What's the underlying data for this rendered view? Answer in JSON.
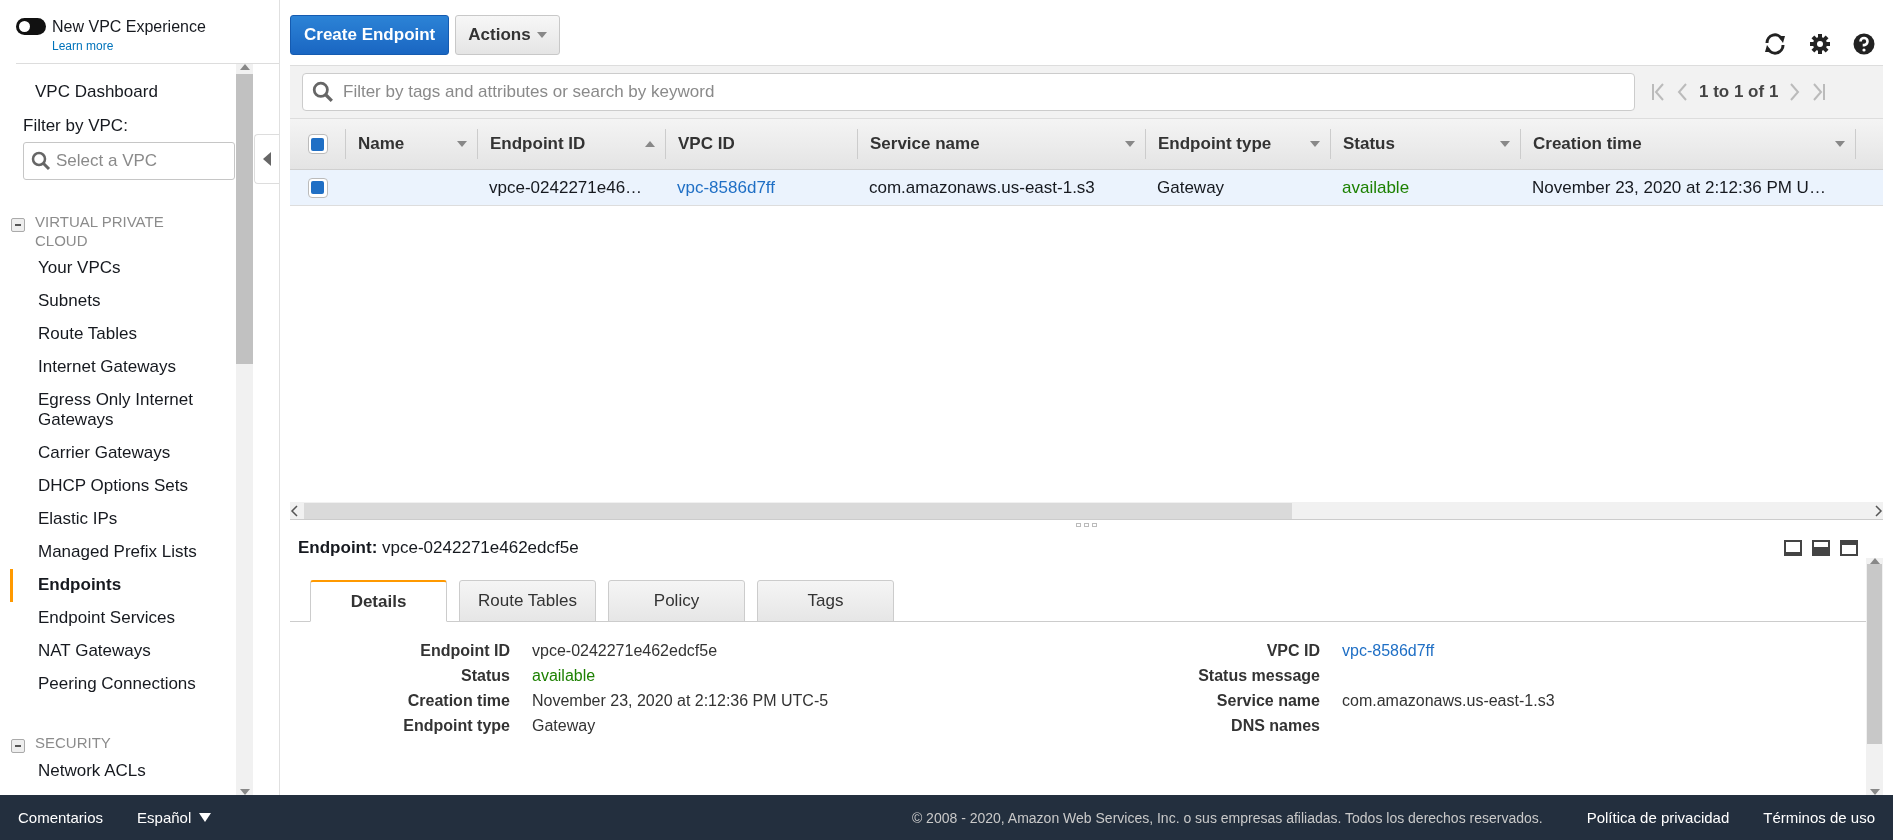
{
  "sidebar": {
    "toggle": {
      "label": "New VPC Experience",
      "on": false
    },
    "learn_more": "Learn more",
    "dashboard": "VPC Dashboard",
    "filter_label": "Filter by VPC:",
    "filter": {
      "placeholder": "Select a VPC"
    },
    "sections": [
      {
        "title": "VIRTUAL PRIVATE CLOUD",
        "expanded": true,
        "items": [
          {
            "label": "Your VPCs",
            "selected": false
          },
          {
            "label": "Subnets",
            "selected": false
          },
          {
            "label": "Route Tables",
            "selected": false
          },
          {
            "label": "Internet Gateways",
            "selected": false
          },
          {
            "label": "Egress Only Internet Gateways",
            "selected": false
          },
          {
            "label": "Carrier Gateways",
            "selected": false
          },
          {
            "label": "DHCP Options Sets",
            "selected": false
          },
          {
            "label": "Elastic IPs",
            "selected": false
          },
          {
            "label": "Managed Prefix Lists",
            "selected": false
          },
          {
            "label": "Endpoints",
            "selected": true
          },
          {
            "label": "Endpoint Services",
            "selected": false
          },
          {
            "label": "NAT Gateways",
            "selected": false
          },
          {
            "label": "Peering Connections",
            "selected": false
          }
        ]
      },
      {
        "title": "SECURITY",
        "expanded": true,
        "items": [
          {
            "label": "Network ACLs",
            "selected": false
          }
        ]
      }
    ]
  },
  "toolbar": {
    "create": "Create Endpoint",
    "actions": "Actions"
  },
  "search": {
    "placeholder": "Filter by tags and attributes or search by keyword"
  },
  "pagination": "1 to 1 of 1",
  "table": {
    "all_checked": true,
    "columns": [
      {
        "label": "Name",
        "sorted": false,
        "menu": true
      },
      {
        "label": "Endpoint ID",
        "sorted": true,
        "menu": false
      },
      {
        "label": "VPC ID",
        "sorted": false,
        "menu": false
      },
      {
        "label": "Service name",
        "sorted": false,
        "menu": true
      },
      {
        "label": "Endpoint type",
        "sorted": false,
        "menu": true
      },
      {
        "label": "Status",
        "sorted": false,
        "menu": true
      },
      {
        "label": "Creation time",
        "sorted": false,
        "menu": true
      }
    ],
    "rows": [
      {
        "selected": true,
        "cells": [
          {
            "kind": "text",
            "text": ""
          },
          {
            "kind": "text",
            "text": "vpce-0242271e46…"
          },
          {
            "kind": "link",
            "text": "vpc-8586d7ff"
          },
          {
            "kind": "text",
            "text": "com.amazonaws.us-east-1.s3"
          },
          {
            "kind": "text",
            "text": "Gateway"
          },
          {
            "kind": "status",
            "text": "available"
          },
          {
            "kind": "text",
            "text": "November 23, 2020 at 2:12:36 PM U…"
          }
        ]
      }
    ]
  },
  "details": {
    "title_label": "Endpoint:",
    "title_value": "vpce-0242271e462edcf5e",
    "tabs": [
      {
        "label": "Details",
        "selected": true
      },
      {
        "label": "Route Tables",
        "selected": false
      },
      {
        "label": "Policy",
        "selected": false
      },
      {
        "label": "Tags",
        "selected": false
      }
    ],
    "left": [
      {
        "label": "Endpoint ID",
        "kind": "text",
        "value": "vpce-0242271e462edcf5e"
      },
      {
        "label": "Status",
        "kind": "status",
        "value": "available"
      },
      {
        "label": "Creation time",
        "kind": "text",
        "value": "November 23, 2020 at 2:12:36 PM UTC-5"
      },
      {
        "label": "Endpoint type",
        "kind": "text",
        "value": "Gateway"
      }
    ],
    "right": [
      {
        "label": "VPC ID",
        "kind": "link",
        "value": "vpc-8586d7ff"
      },
      {
        "label": "Status message"
      },
      {
        "label": "Service name",
        "kind": "text",
        "value": "com.amazonaws.us-east-1.s3"
      },
      {
        "label": "DNS names"
      }
    ]
  },
  "footer": {
    "feedback": "Comentarios",
    "language": "Español",
    "copyright": "© 2008 - 2020, Amazon Web Services, Inc. o sus empresas afiliadas. Todos los derechos reservados.",
    "links": [
      "Política de privacidad",
      "Términos de uso"
    ]
  }
}
